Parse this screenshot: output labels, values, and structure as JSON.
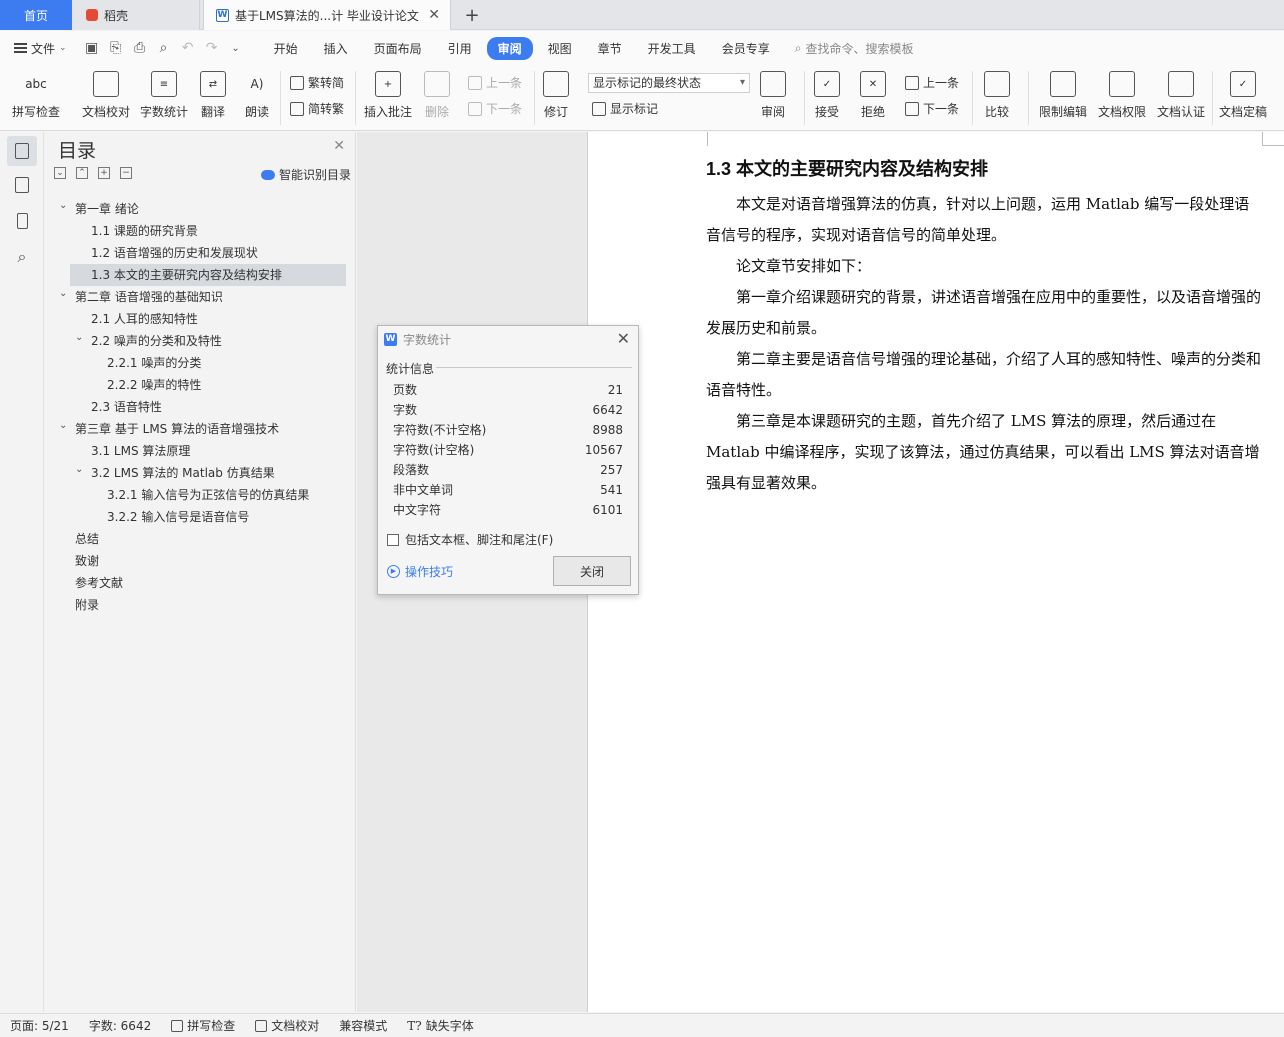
{
  "tabs": {
    "home": "首页",
    "daoke": "稻壳",
    "doc": "基于LMS算法的...计 毕业设计论文"
  },
  "menu": {
    "file": "文件",
    "tabs": [
      "开始",
      "插入",
      "页面布局",
      "引用",
      "审阅",
      "视图",
      "章节",
      "开发工具",
      "会员专享"
    ],
    "active_tab": "审阅",
    "search": "查找命令、搜索模板"
  },
  "ribbon": {
    "spell_check": "拼写检查",
    "doc_proof": "文档校对",
    "word_count": "字数统计",
    "translate": "翻译",
    "read_aloud": "朗读",
    "trad_to_simp": "繁转简",
    "simp_to_trad": "简转繁",
    "insert_comment": "插入批注",
    "delete": "删除",
    "prev": "上一条",
    "next": "下一条",
    "track": "修订",
    "markup_state": "显示标记的最终状态",
    "show_markup": "显示标记",
    "review": "审阅",
    "accept": "接受",
    "reject": "拒绝",
    "prev2": "上一条",
    "next2": "下一条",
    "compare": "比较",
    "restrict_edit": "限制编辑",
    "doc_permission": "文档权限",
    "doc_cert": "文档认证",
    "doc_finalize": "文档定稿"
  },
  "toc": {
    "title": "目录",
    "smart": "智能识别目录",
    "items": [
      {
        "text": "第一章  绪论",
        "level": 1,
        "expanded": true
      },
      {
        "text": "1.1  课题的研究背景",
        "level": 2
      },
      {
        "text": "1.2  语音增强的历史和发展现状",
        "level": 2
      },
      {
        "text": "1.3  本文的主要研究内容及结构安排",
        "level": 2,
        "active": true
      },
      {
        "text": "第二章  语音增强的基础知识",
        "level": 1,
        "expanded": true
      },
      {
        "text": "2.1  人耳的感知特性",
        "level": 2
      },
      {
        "text": "2.2  噪声的分类和及特性",
        "level": 2,
        "expanded": true
      },
      {
        "text": "2.2.1  噪声的分类",
        "level": 3
      },
      {
        "text": "2.2.2  噪声的特性",
        "level": 3
      },
      {
        "text": "2.3 语音特性",
        "level": 2
      },
      {
        "text": "第三章  基于 LMS 算法的语音增强技术",
        "level": 1,
        "expanded": true
      },
      {
        "text": "3.1 LMS 算法原理",
        "level": 2
      },
      {
        "text": "3.2 LMS 算法的 Matlab 仿真结果",
        "level": 2,
        "expanded": true
      },
      {
        "text": "3.2.1  输入信号为正弦信号的仿真结果",
        "level": 3
      },
      {
        "text": "3.2.2  输入信号是语音信号",
        "level": 3
      },
      {
        "text": "总结",
        "level": 0
      },
      {
        "text": "致谢",
        "level": 0
      },
      {
        "text": "参考文献",
        "level": 0
      },
      {
        "text": "附录",
        "level": 0
      }
    ]
  },
  "document": {
    "heading": "1.3  本文的主要研究内容及结构安排",
    "paragraphs": [
      "本文是对语音增强算法的仿真，针对以上问题，运用 Matlab 编写一段处理语音信号的程序，实现对语音信号的简单处理。",
      "论文章节安排如下：",
      "第一章介绍课题研究的背景，讲述语音增强在应用中的重要性，以及语音增强的发展历史和前景。",
      "第二章主要是语音信号增强的理论基础，介绍了人耳的感知特性、噪声的分类和语音特性。",
      "第三章是本课题研究的主题，首先介绍了 LMS 算法的原理，然后通过在 Matlab 中编译程序，实现了该算法，通过仿真结果，可以看出 LMS 算法对语音增强具有显著效果。"
    ]
  },
  "dialog": {
    "title": "字数统计",
    "section": "统计信息",
    "stats": [
      {
        "label": "页数",
        "value": "21"
      },
      {
        "label": "字数",
        "value": "6642"
      },
      {
        "label": "字符数(不计空格)",
        "value": "8988"
      },
      {
        "label": "字符数(计空格)",
        "value": "10567"
      },
      {
        "label": "段落数",
        "value": "257"
      },
      {
        "label": "非中文单词",
        "value": "541"
      },
      {
        "label": "中文字符",
        "value": "6101"
      }
    ],
    "checkbox": "包括文本框、脚注和尾注(F)",
    "tips": "操作技巧",
    "close": "关闭"
  },
  "status": {
    "page": "页面: 5/21",
    "words": "字数: 6642",
    "spell": "拼写检查",
    "proof": "文档校对",
    "compat": "兼容模式",
    "missing_font": "缺失字体"
  },
  "colors": {
    "accent": "#3c7cf0",
    "toc_active_bg": "#d6d9de"
  }
}
